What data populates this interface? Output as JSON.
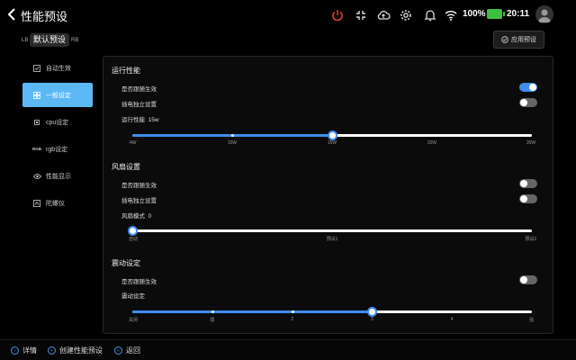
{
  "header": {
    "title": "性能预设",
    "battery_percent": "100%",
    "time": "20:11"
  },
  "preset": {
    "lb": "LB",
    "rb": "RB",
    "name": "默认预设",
    "apply_label": "应用预设"
  },
  "sidebar": {
    "items": [
      {
        "label": "自动生效",
        "icon": "auto-apply-icon"
      },
      {
        "label": "一般设定",
        "icon": "general-settings-icon"
      },
      {
        "label": "cpu设定",
        "icon": "cpu-icon"
      },
      {
        "label": "rgb设定",
        "icon": "rgb-icon",
        "icon_text": "RGB"
      },
      {
        "label": "性能显示",
        "icon": "performance-display-icon"
      },
      {
        "label": "陀螺仪",
        "icon": "gyroscope-icon"
      }
    ]
  },
  "sections": {
    "run": {
      "title": "运行性能",
      "toggle1_label": "是否跟随生效",
      "toggle1_on": true,
      "toggle2_label": "插电独立设置",
      "toggle2_on": false,
      "slider_label": "运行性能",
      "slider_value": "15w",
      "ticks": [
        "4W",
        "10W",
        "15W",
        "20W",
        "30W"
      ],
      "value_index": 2
    },
    "fan": {
      "title": "风扇设置",
      "toggle1_label": "是否跟随生效",
      "toggle1_on": false,
      "toggle2_label": "插电独立设置",
      "toggle2_on": false,
      "slider_label": "风扇模式",
      "slider_value": "0",
      "ticks": [
        "自动",
        "预设1",
        "预设2"
      ],
      "value_index": 0
    },
    "vibration": {
      "title": "震动设定",
      "toggle1_label": "是否跟随生效",
      "toggle1_on": false,
      "slider_label": "震动设定",
      "ticks": [
        "关闭",
        "弱",
        "2",
        "3",
        "4",
        "强"
      ],
      "value_index": 3
    }
  },
  "footer": {
    "details": "详情",
    "create_preset": "创建性能预设",
    "back": "返回"
  },
  "colors": {
    "accent": "#3e8ef0",
    "sidebar_active": "#5bb8f5",
    "power_icon": "#e53935",
    "battery": "#3fbf3f"
  }
}
